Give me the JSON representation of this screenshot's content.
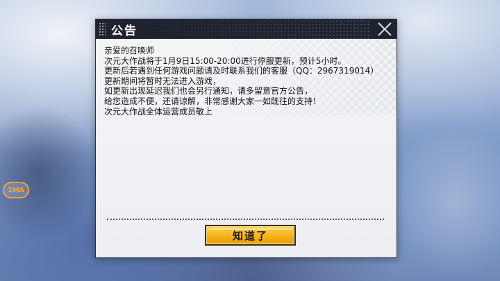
{
  "logo": {
    "text": "ΣMA",
    "color": "#f3a33a"
  },
  "dialog": {
    "title": "公告",
    "close_icon": "close-icon",
    "lines": [
      "亲爱的召唤师",
      "次元大作战将于1月9日15:00-20:00进行停服更新，预计5小时。",
      "更新后若遇到任何游戏问题请及时联系我们的客服（QQ：2967319014）",
      "更新期间将暂时无法进入游戏，",
      "如更新出现延迟我们也会另行通知，请多留意官方公告，",
      "给您造成不便，还请谅解，非常感谢大家一如既往的支持！",
      "次元大作战全体运营成员敬上"
    ],
    "ok_label": "知道了",
    "ok_color": "#f4b018",
    "title_bar_color": "#1f2330"
  }
}
